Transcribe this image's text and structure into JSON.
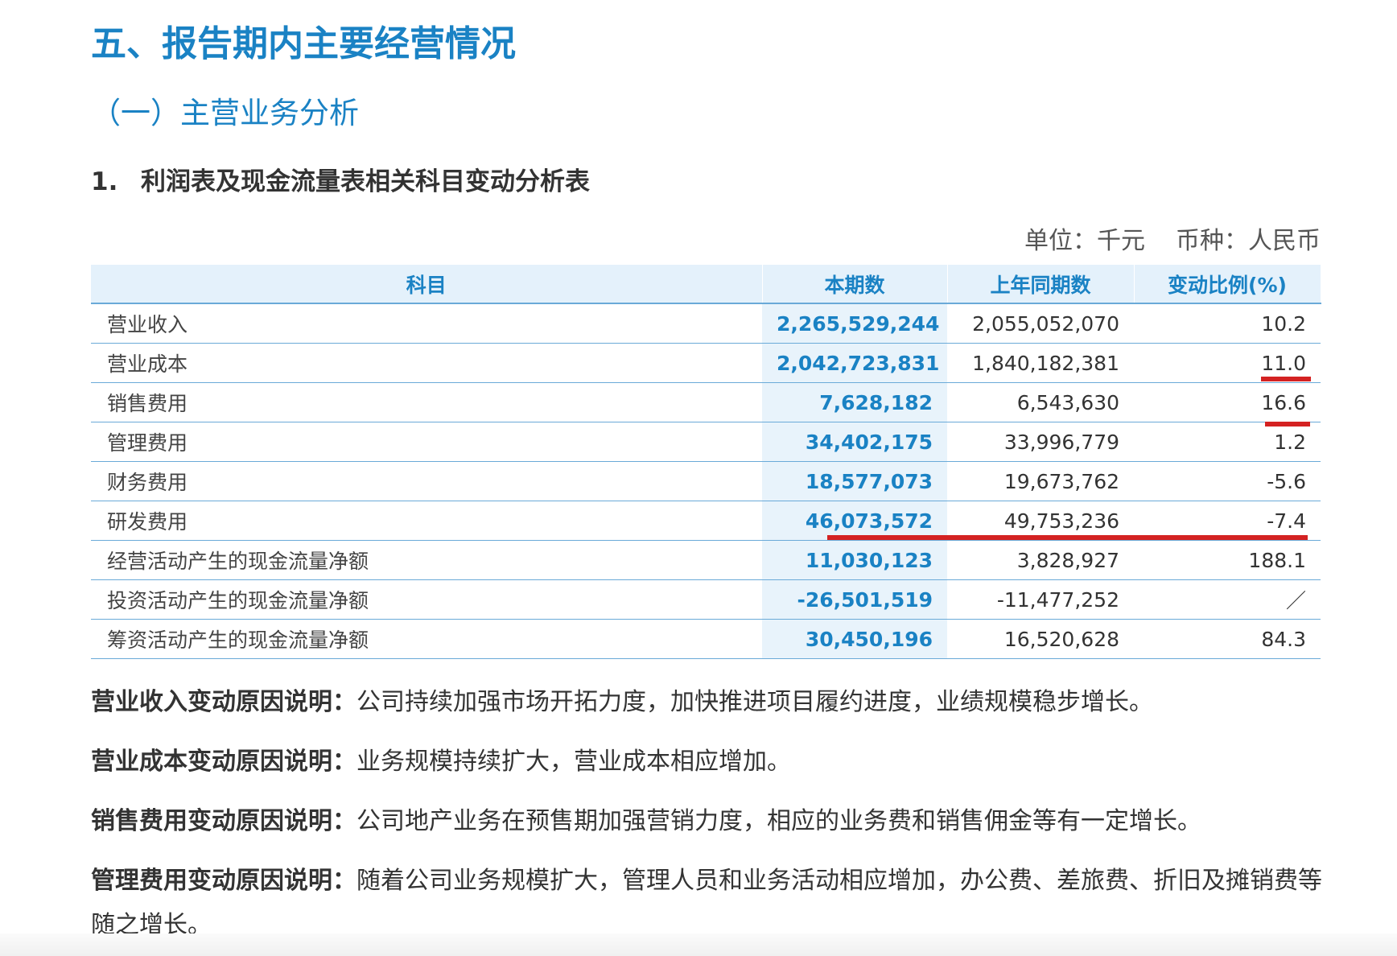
{
  "heading": "五、报告期内主要经营情况",
  "subheading": "（一）主营业务分析",
  "section": {
    "number": "1.",
    "title": "利润表及现金流量表相关科目变动分析表"
  },
  "unit": {
    "unit_label": "单位：千元",
    "currency_label": "币种：人民币"
  },
  "table": {
    "headers": [
      "科目",
      "本期数",
      "上年同期数",
      "变动比例(%)"
    ],
    "rows": [
      {
        "item": "营业收入",
        "current": "2,265,529,244",
        "previous": "2,055,052,070",
        "change": "10.2"
      },
      {
        "item": "营业成本",
        "current": "2,042,723,831",
        "previous": "1,840,182,381",
        "change": "11.0"
      },
      {
        "item": "销售费用",
        "current": "7,628,182",
        "previous": "6,543,630",
        "change": "16.6"
      },
      {
        "item": "管理费用",
        "current": "34,402,175",
        "previous": "33,996,779",
        "change": "1.2"
      },
      {
        "item": "财务费用",
        "current": "18,577,073",
        "previous": "19,673,762",
        "change": "-5.6"
      },
      {
        "item": "研发费用",
        "current": "46,073,572",
        "previous": "49,753,236",
        "change": "-7.4"
      },
      {
        "item": "经营活动产生的现金流量净额",
        "current": "11,030,123",
        "previous": "3,828,927",
        "change": "188.1"
      },
      {
        "item": "投资活动产生的现金流量净额",
        "current": "-26,501,519",
        "previous": "-11,477,252",
        "change": "／"
      },
      {
        "item": "筹资活动产生的现金流量净额",
        "current": "30,450,196",
        "previous": "16,520,628",
        "change": "84.3"
      }
    ]
  },
  "annotation_color": "#d42222",
  "explanations": [
    {
      "label": "营业收入变动原因说明：",
      "text": "公司持续加强市场开拓力度，加快推进项目履约进度，业绩规模稳步增长。"
    },
    {
      "label": "营业成本变动原因说明：",
      "text": "业务规模持续扩大，营业成本相应增加。"
    },
    {
      "label": "销售费用变动原因说明：",
      "text": "公司地产业务在预售期加强营销力度，相应的业务费和销售佣金等有一定增长。"
    },
    {
      "label": "管理费用变动原因说明：",
      "text": "随着公司业务规模扩大，管理人员和业务活动相应增加，办公费、差旅费、折旧及摊销费等随之增长。"
    }
  ]
}
